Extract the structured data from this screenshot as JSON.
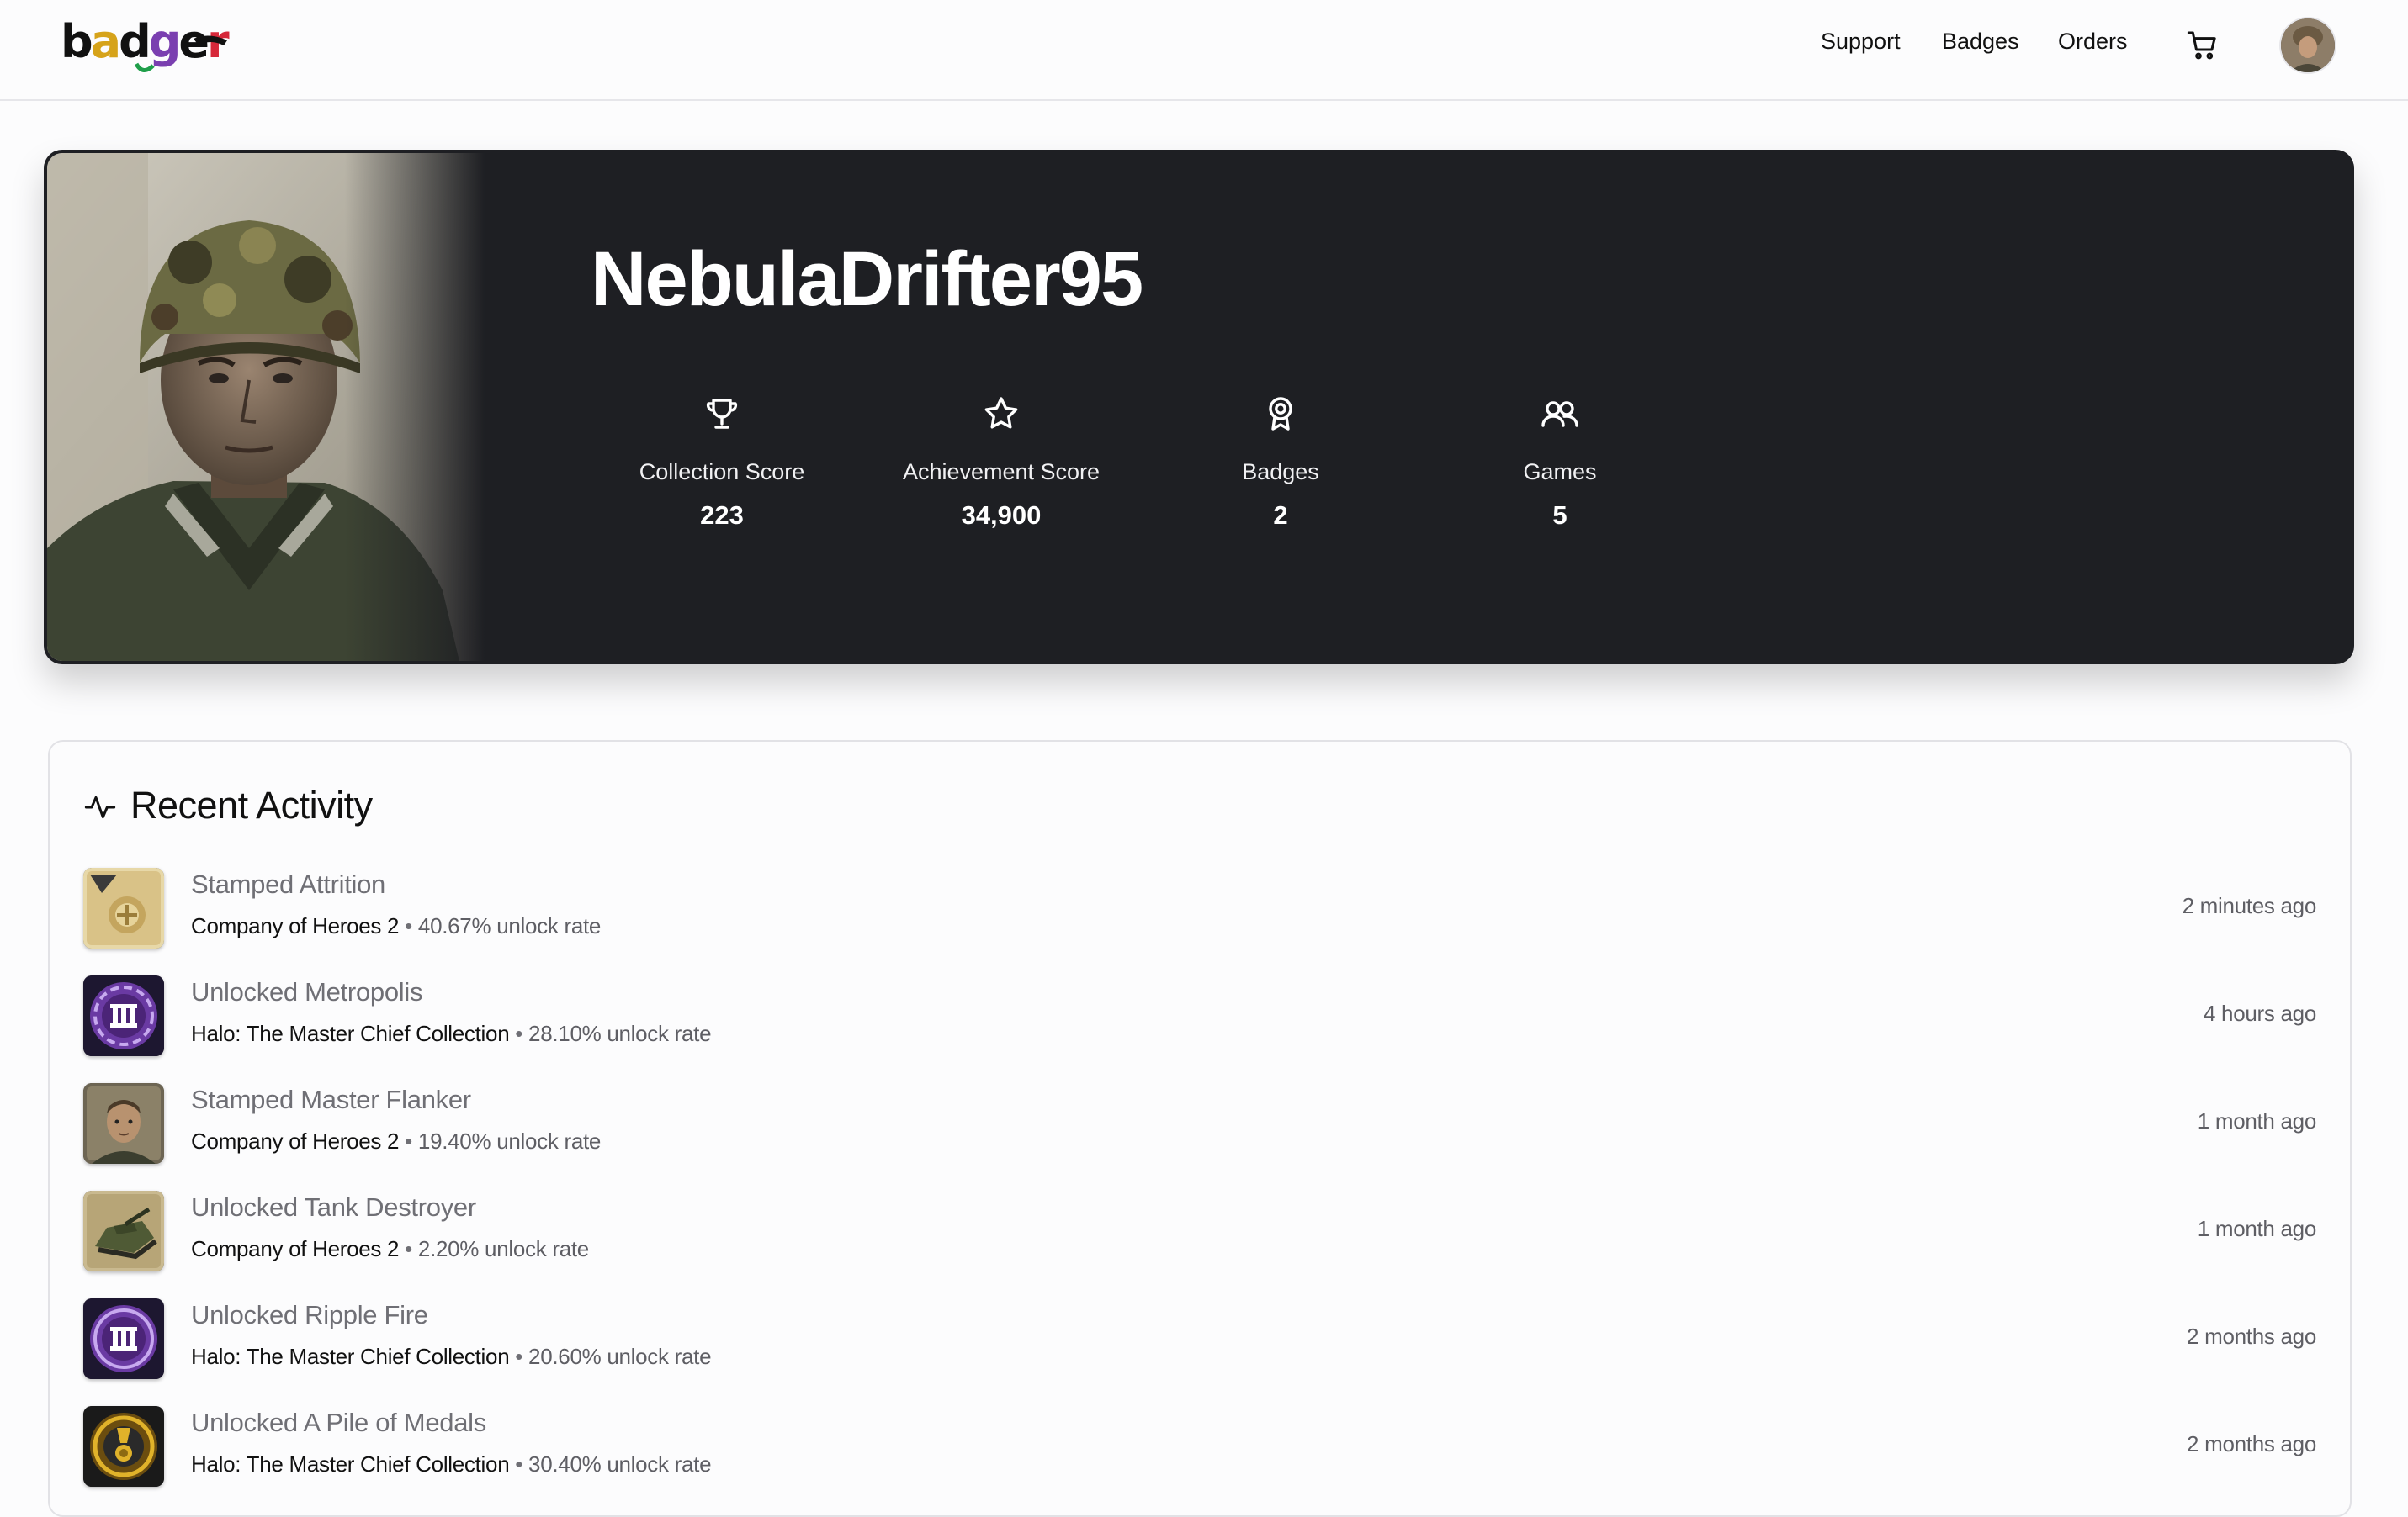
{
  "brand": {
    "logo_text": "badger"
  },
  "nav": {
    "links": [
      "Support",
      "Badges",
      "Orders"
    ],
    "cart_icon": "cart-icon",
    "avatar_icon": "user-avatar"
  },
  "profile": {
    "username": "NebulaDrifter95",
    "stats": [
      {
        "icon": "trophy-icon",
        "label": "Collection Score",
        "value": "223"
      },
      {
        "icon": "star-icon",
        "label": "Achievement Score",
        "value": "34,900"
      },
      {
        "icon": "award-icon",
        "label": "Badges",
        "value": "2"
      },
      {
        "icon": "users-icon",
        "label": "Games",
        "value": "5"
      }
    ]
  },
  "activity": {
    "title": "Recent Activity",
    "icon": "activity-icon",
    "items": [
      {
        "title": "Stamped Attrition",
        "game": "Company of Heroes 2",
        "rate": "40.67% unlock rate",
        "time": "2 minutes ago"
      },
      {
        "title": "Unlocked Metropolis",
        "game": "Halo: The Master Chief Collection",
        "rate": "28.10% unlock rate",
        "time": "4 hours ago"
      },
      {
        "title": "Stamped Master Flanker",
        "game": "Company of Heroes 2",
        "rate": "19.40% unlock rate",
        "time": "1 month ago"
      },
      {
        "title": "Unlocked Tank Destroyer",
        "game": "Company of Heroes 2",
        "rate": "2.20% unlock rate",
        "time": "1 month ago"
      },
      {
        "title": "Unlocked Ripple Fire",
        "game": "Halo: The Master Chief Collection",
        "rate": "20.60% unlock rate",
        "time": "2 months ago"
      },
      {
        "title": "Unlocked A Pile of Medals",
        "game": "Halo: The Master Chief Collection",
        "rate": "30.40% unlock rate",
        "time": "2 months ago"
      }
    ],
    "separator": "•"
  },
  "colors": {
    "hero_bg": "#1e1f23",
    "page_bg": "#fcfcfd",
    "muted_text": "#6f6f75",
    "halo_purple": "#5b2f8f",
    "medal_gold": "#d4a21c"
  }
}
